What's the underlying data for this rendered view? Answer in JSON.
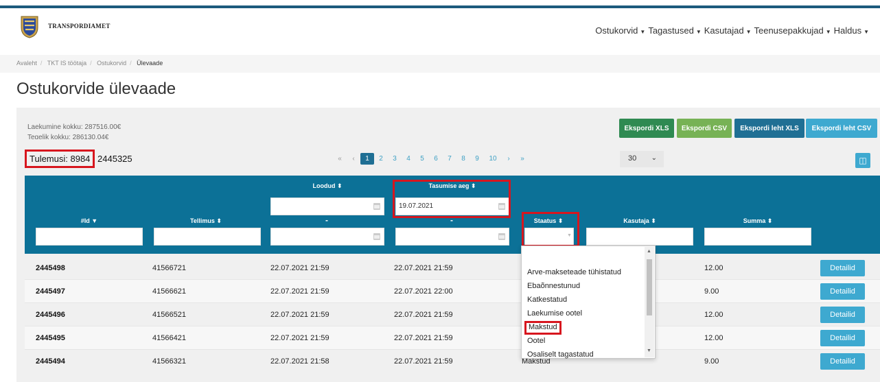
{
  "header": {
    "brand": "Transpordiamet",
    "nav": [
      {
        "label": "Ostukorvid"
      },
      {
        "label": "Tagastused"
      },
      {
        "label": "Kasutajad"
      },
      {
        "label": "Teenusepakkujad"
      },
      {
        "label": "Haldus"
      }
    ]
  },
  "breadcrumb": [
    "Avaleht",
    "TKT IS töötaja",
    "Ostukorvid",
    "Ülevaade"
  ],
  "page_title": "Ostukorvide ülevaade",
  "stats": {
    "laekumine": "Laekumine kokku: 287516.00€",
    "tegelik": "Tegelik kokku: 286130.04€",
    "results_label": "Tulemusi: 8984",
    "results_extra": "2445325"
  },
  "export_buttons": [
    {
      "label": "Ekspordi XLS",
      "color": "#2f8a52"
    },
    {
      "label": "Ekspordi CSV",
      "color": "#77b255"
    },
    {
      "label": "Ekspordi leht XLS",
      "color": "#1f6f94"
    },
    {
      "label": "Ekspordi leht CSV",
      "color": "#3ea9d0"
    }
  ],
  "pagination": {
    "first": "«",
    "prev": "‹",
    "pages": [
      "1",
      "2",
      "3",
      "4",
      "5",
      "6",
      "7",
      "8",
      "9",
      "10"
    ],
    "current": "1",
    "next": "›",
    "last": "»",
    "per_page": "30"
  },
  "columns": {
    "id": "#Id",
    "tellimus": "Tellimus",
    "loodud": "Loodud",
    "tasumise_aeg": "Tasumise aeg",
    "staatus": "Staatus",
    "kasutaja": "Kasutaja",
    "summa": "Summa"
  },
  "filters": {
    "tasumise_from": "19.07.2021",
    "dash": "-"
  },
  "rows": [
    {
      "id": "2445498",
      "tellimus": "41566721",
      "loodud": "22.07.2021 21:59",
      "tasumise": "22.07.2021 21:59",
      "staatus": "",
      "summa": "12.00",
      "action": "Detailid"
    },
    {
      "id": "2445497",
      "tellimus": "41566621",
      "loodud": "22.07.2021 21:59",
      "tasumise": "22.07.2021 22:00",
      "staatus": "",
      "summa": "9.00",
      "action": "Detailid"
    },
    {
      "id": "2445496",
      "tellimus": "41566521",
      "loodud": "22.07.2021 21:59",
      "tasumise": "22.07.2021 21:59",
      "staatus": "",
      "summa": "12.00",
      "action": "Detailid"
    },
    {
      "id": "2445495",
      "tellimus": "41566421",
      "loodud": "22.07.2021 21:59",
      "tasumise": "22.07.2021 21:59",
      "staatus": "",
      "summa": "12.00",
      "action": "Detailid"
    },
    {
      "id": "2445494",
      "tellimus": "41566321",
      "loodud": "22.07.2021 21:58",
      "tasumise": "22.07.2021 21:59",
      "staatus": "Makstud",
      "summa": "9.00",
      "action": "Detailid"
    }
  ],
  "status_options": [
    "Arve-makseteade tühistatud",
    "Ebaõnnestunud",
    "Katkestatud",
    "Laekumise ootel",
    "Makstud",
    "Ootel",
    "Osaliselt tagastatud"
  ],
  "colors": {
    "table_header": "#0c7197",
    "highlight": "#d7161e",
    "detail_button": "#3ea9d0"
  }
}
